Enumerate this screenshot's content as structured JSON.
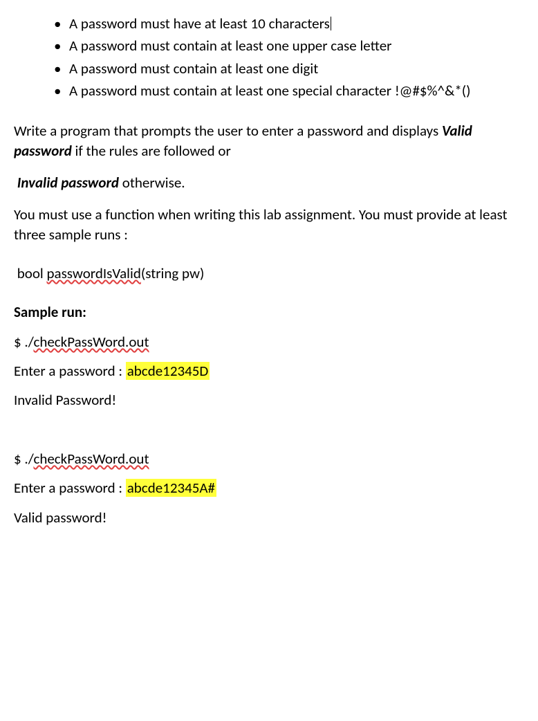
{
  "rules": [
    {
      "text": "A password must have at least 10 characters",
      "cursor": true
    },
    {
      "text": "A password must contain at least one upper case letter",
      "cursor": false
    },
    {
      "text": "A password must contain at least one digit",
      "cursor": false
    },
    {
      "text": "A password must contain at least one special character !@#$%^&*()",
      "cursor": false
    }
  ],
  "para1": {
    "pre": "Write a program that prompts the user to enter a password and displays ",
    "emph": "Valid password",
    "post": " if the rules are followed or"
  },
  "para2": {
    "emph": "Invalid password",
    "post": " otherwise."
  },
  "para3": "You must use a function when writing this lab assignment. You must provide at least three sample runs :",
  "func": {
    "ret": "bool   ",
    "name": "passwordIsValid",
    "args": "(string   pw)"
  },
  "sample_heading": "Sample run:",
  "run1": {
    "cmd_prefix": "$   ./",
    "cmd_name": "checkPassWord.out",
    "prompt": "Enter a password  :  ",
    "input": "abcde12345D",
    "result": "Invalid Password!"
  },
  "run2": {
    "cmd_prefix": "$  ./",
    "cmd_name": "checkPassWord.out",
    "prompt": "Enter a password  :  ",
    "input": "abcde12345A#",
    "result": "Valid password!"
  }
}
